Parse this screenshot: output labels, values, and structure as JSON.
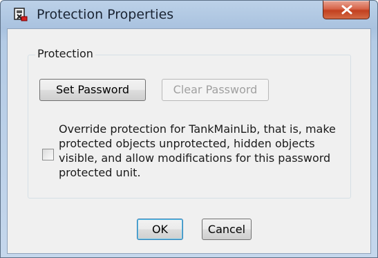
{
  "window": {
    "title": "Protection Properties"
  },
  "group": {
    "label": "Protection"
  },
  "buttons": {
    "set_password": "Set Password",
    "clear_password": "Clear Password",
    "ok": "OK",
    "cancel": "Cancel"
  },
  "override": {
    "checked": false,
    "text": "Override protection for TankMainLib, that is, make protected objects unprotected, hidden objects visible, and allow modifications for this password protected unit."
  },
  "icons": {
    "app": "protection-lock-icon",
    "close": "close-icon"
  },
  "colors": {
    "close_button": "#c9462a",
    "title_bar": "#b4cbe5",
    "client_background": "#f0f0f0",
    "default_button_focus": "#5bc3ed"
  }
}
